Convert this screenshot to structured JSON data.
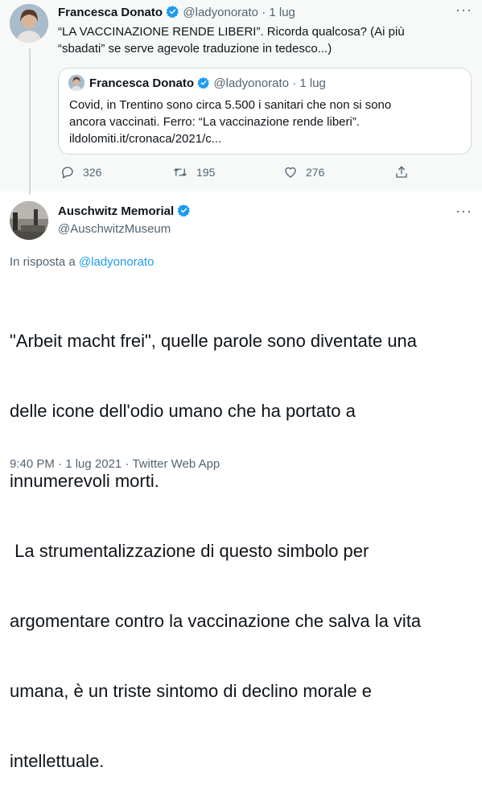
{
  "parent_tweet": {
    "author_name": "Francesca Donato",
    "author_handle": "@ladyonorato",
    "separator": "·",
    "date": "1 lug",
    "more_label": "···",
    "text_line1": "“LA VACCINAZIONE RENDE LIBERI”. Ricorda qualcosa? (Ai più",
    "text_line2": "“sbadati” se serve agevole traduzione in tedesco...)",
    "quoted": {
      "author_name": "Francesca Donato",
      "author_handle": "@ladyonorato",
      "separator": "·",
      "date": "1 lug",
      "text_line1": "Covid, in Trentino sono circa 5.500 i sanitari che non si sono",
      "text_line2": "ancora vaccinati. Ferro: “La vaccinazione rende liberi”.",
      "text_line3": "ildolomiti.it/cronaca/2021/c..."
    },
    "actions": {
      "replies": "326",
      "retweets": "195",
      "likes": "276"
    }
  },
  "reply_tweet": {
    "author_name": "Auschwitz Memorial",
    "author_handle": "@AuschwitzMuseum",
    "more_label": "···",
    "reply_to_prefix": "In risposta a",
    "reply_to_handle": "@ladyonorato",
    "text_lines": [
      "\"Arbeit macht frei\", quelle parole sono diventate una",
      "delle icone dell'odio umano che ha portato a",
      "innumerevoli morti.",
      " La strumentalizzazione di questo simbolo per",
      "argomentare contro la vaccinazione che salva la vita",
      "umana, è un triste sintomo di declino morale e",
      "intellettuale."
    ],
    "timestamp": "9:40 PM · 1 lug 2021 · Twitter Web App"
  },
  "colors": {
    "accent": "#1d9bf0",
    "secondary_text": "#536471",
    "border": "#cfd9de"
  }
}
